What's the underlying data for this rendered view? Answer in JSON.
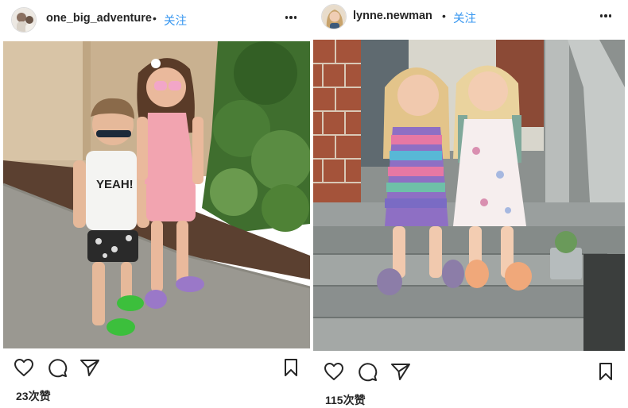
{
  "posts": [
    {
      "username": "one_big_adventure",
      "separator": "•",
      "follow_label": "关注",
      "likes": "23次赞",
      "photo_shirt_text": "YEAH!",
      "icons": [
        "heart-icon",
        "comment-icon",
        "share-icon",
        "bookmark-icon",
        "more-icon"
      ]
    },
    {
      "username": "lynne.newman",
      "separator": "•",
      "follow_label": "关注",
      "likes": "115次赞",
      "icons": [
        "heart-icon",
        "comment-icon",
        "share-icon",
        "bookmark-icon",
        "more-icon"
      ]
    }
  ],
  "colors": {
    "follow": "#3897f0",
    "text": "#262626",
    "border": "#dbdbdb"
  }
}
